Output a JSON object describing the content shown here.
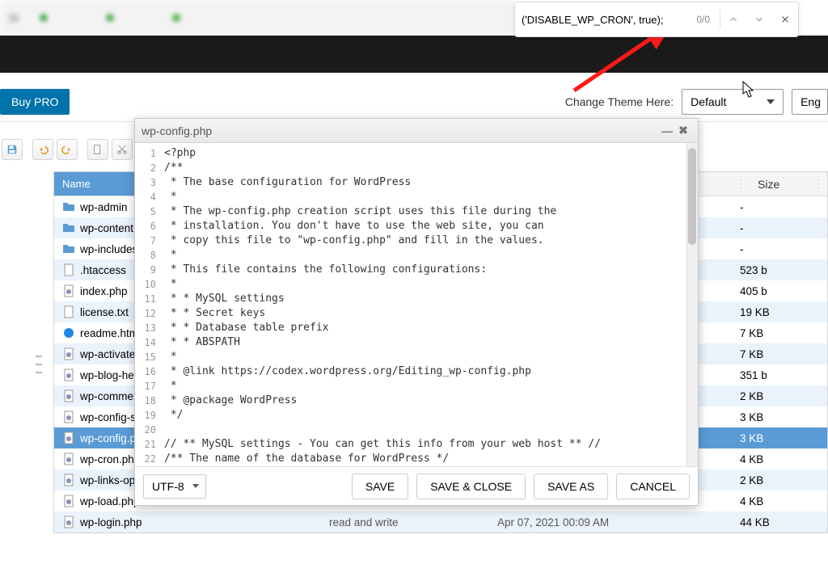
{
  "find": {
    "query": "('DISABLE_WP_CRON', true);",
    "count": "0/0"
  },
  "toolbar": {
    "buy_pro": "Buy PRO",
    "theme_label": "Change Theme Here:",
    "theme_value": "Default",
    "lang": "Eng"
  },
  "table": {
    "headers": {
      "name": "Name",
      "size": "Size"
    },
    "rows": [
      {
        "icon": "folder",
        "name": "wp-admin",
        "perm": "",
        "mod": "",
        "size": "-"
      },
      {
        "icon": "folder",
        "name": "wp-content",
        "perm": "",
        "mod": "",
        "size": "-"
      },
      {
        "icon": "folder",
        "name": "wp-includes",
        "perm": "",
        "mod": "",
        "size": "-"
      },
      {
        "icon": "file",
        "name": ".htaccess",
        "perm": "",
        "mod": "",
        "size": "523 b"
      },
      {
        "icon": "php",
        "name": "index.php",
        "perm": "",
        "mod": "",
        "size": "405 b"
      },
      {
        "icon": "file",
        "name": "license.txt",
        "perm": "",
        "mod": "",
        "size": "19 KB"
      },
      {
        "icon": "html",
        "name": "readme.html",
        "perm": "",
        "mod": "",
        "size": "7 KB"
      },
      {
        "icon": "php",
        "name": "wp-activate.php",
        "perm": "",
        "mod": "",
        "size": "7 KB"
      },
      {
        "icon": "php",
        "name": "wp-blog-header.php",
        "perm": "",
        "mod": "",
        "size": "351 b"
      },
      {
        "icon": "php",
        "name": "wp-comments-post.php",
        "perm": "",
        "mod": "",
        "size": "2 KB"
      },
      {
        "icon": "php",
        "name": "wp-config-sample.php",
        "perm": "",
        "mod": "",
        "size": "3 KB"
      },
      {
        "icon": "php",
        "name": "wp-config.php",
        "perm": "",
        "mod": "",
        "size": "3 KB",
        "selected": true
      },
      {
        "icon": "php",
        "name": "wp-cron.php",
        "perm": "",
        "mod": "",
        "size": "4 KB"
      },
      {
        "icon": "php",
        "name": "wp-links-opml.php",
        "perm": "",
        "mod": "",
        "size": "2 KB"
      },
      {
        "icon": "php",
        "name": "wp-load.php",
        "perm": "",
        "mod": "",
        "size": "4 KB"
      },
      {
        "icon": "php",
        "name": "wp-login.php",
        "perm": "read and write",
        "mod": "Apr 07, 2021 00:09 AM",
        "size": "44 KB"
      }
    ]
  },
  "editor": {
    "title": "wp-config.php",
    "encoding": "UTF-8",
    "buttons": {
      "save": "SAVE",
      "save_close": "SAVE & CLOSE",
      "save_as": "SAVE AS",
      "cancel": "CANCEL"
    },
    "lines": [
      "<?php",
      "/**",
      " * The base configuration for WordPress",
      " *",
      " * The wp-config.php creation script uses this file during the",
      " * installation. You don't have to use the web site, you can",
      " * copy this file to \"wp-config.php\" and fill in the values.",
      " *",
      " * This file contains the following configurations:",
      " *",
      " * * MySQL settings",
      " * * Secret keys",
      " * * Database table prefix",
      " * * ABSPATH",
      " *",
      " * @link https://codex.wordpress.org/Editing_wp-config.php",
      " *",
      " * @package WordPress",
      " */",
      "",
      "// ** MySQL settings - You can get this info from your web host ** //",
      "/** The name of the database for WordPress */"
    ]
  }
}
